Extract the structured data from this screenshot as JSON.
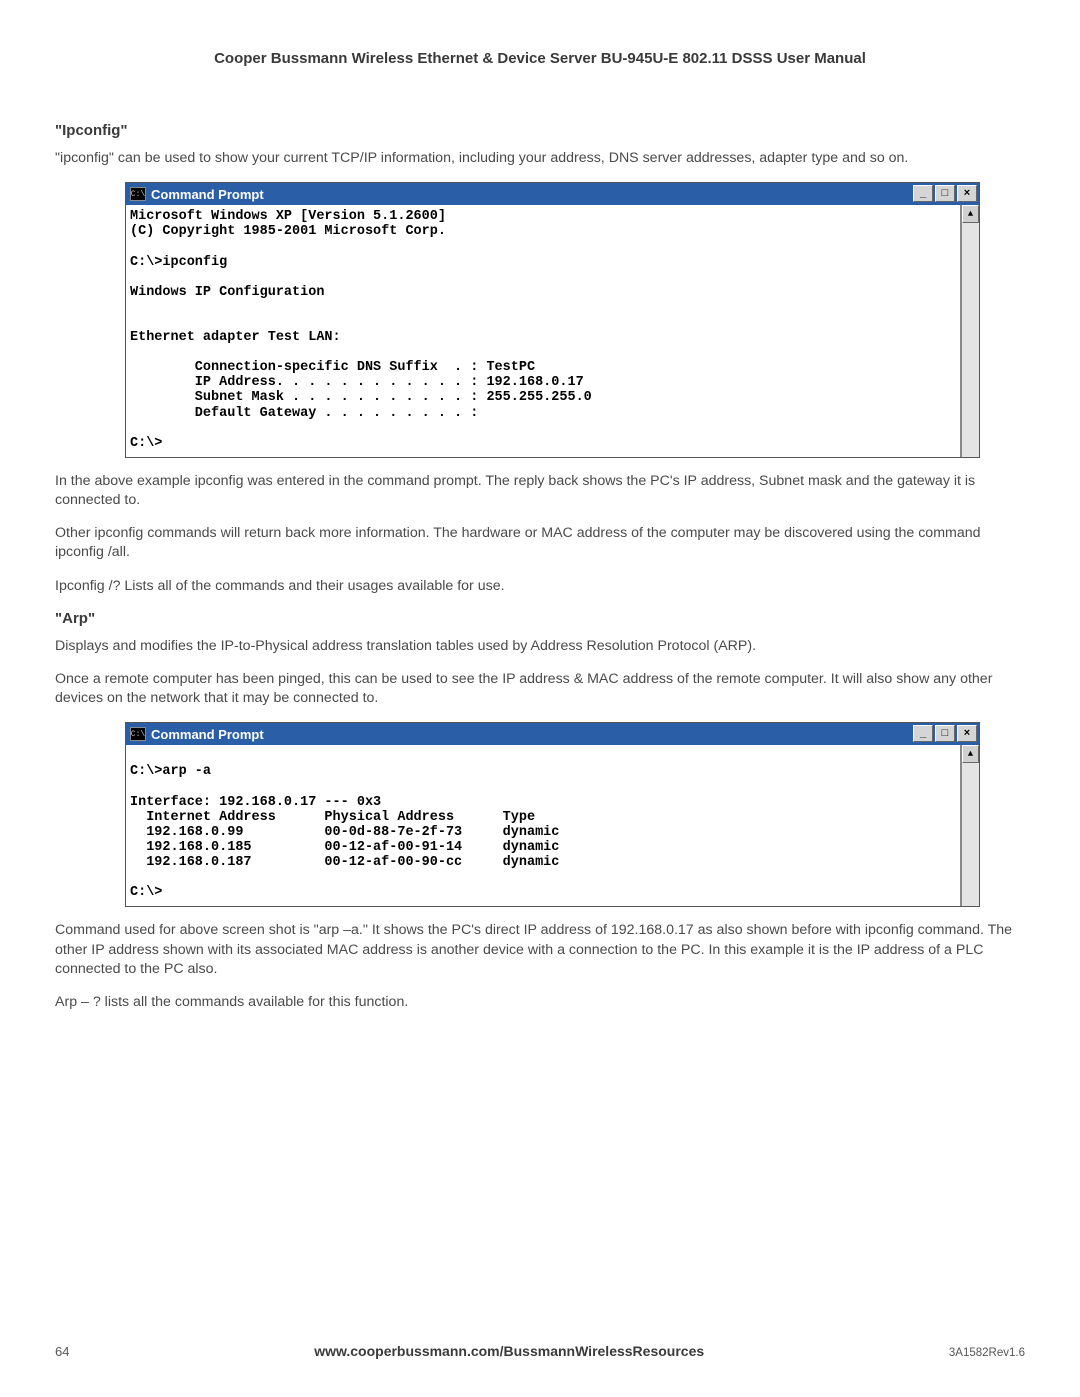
{
  "header": {
    "title": "Cooper Bussmann Wireless Ethernet & Device Server BU-945U-E 802.11 DSSS User Manual"
  },
  "sections": {
    "ipconfig": {
      "heading": "\"Ipconfig\"",
      "para1": "\"ipconfig\" can be used to show your current TCP/IP information, including your address, DNS server addresses, adapter type and so on.",
      "para_after1": "In the above example ipconfig was entered in the command prompt. The reply back shows the PC's IP address, Subnet mask and the gateway it is connected to.",
      "para_after2": "Other ipconfig commands will return back more information. The hardware or MAC address of the computer may be discovered using the command ipconfig /all.",
      "para_after3": "Ipconfig /? Lists all of the commands and their usages available for use."
    },
    "arp": {
      "heading": "\"Arp\"",
      "para1": "Displays and modifies the IP-to-Physical address translation tables used by Address Resolution Protocol (ARP).",
      "para2": "Once a remote computer has been pinged, this can be used to see the IP address & MAC address of the remote computer. It will also show any other devices on the network that it may be connected to.",
      "para_after1": "Command used for above screen shot is \"arp –a.\" It shows the PC's direct IP address of 192.168.0.17 as also shown before with ipconfig command. The other IP address shown with its associated MAC address is another device with a connection to the PC. In this example it is the IP address of a PLC connected to the PC also.",
      "para_after2": "Arp – ? lists all the commands available for this function."
    }
  },
  "cmd1": {
    "title": "Command Prompt",
    "icon_label": "C:\\",
    "body": "Microsoft Windows XP [Version 5.1.2600]\n(C) Copyright 1985-2001 Microsoft Corp.\n\nC:\\>ipconfig\n\nWindows IP Configuration\n\n\nEthernet adapter Test LAN:\n\n        Connection-specific DNS Suffix  . : TestPC\n        IP Address. . . . . . . . . . . . : 192.168.0.17\n        Subnet Mask . . . . . . . . . . . : 255.255.255.0\n        Default Gateway . . . . . . . . . :\n\nC:\\>"
  },
  "cmd2": {
    "title": "Command Prompt",
    "icon_label": "C:\\",
    "body": "\nC:\\>arp -a\n\nInterface: 192.168.0.17 --- 0x3\n  Internet Address      Physical Address      Type\n  192.168.0.99          00-0d-88-7e-2f-73     dynamic\n  192.168.0.185         00-12-af-00-91-14     dynamic\n  192.168.0.187         00-12-af-00-90-cc     dynamic\n\nC:\\>"
  },
  "window_buttons": {
    "minimize": "_",
    "maximize": "□",
    "close": "×",
    "scroll_up": "▲",
    "scroll_down": "▼"
  },
  "footer": {
    "page": "64",
    "url": "www.cooperbussmann.com/BussmannWirelessResources",
    "rev": "3A1582Rev1.6"
  }
}
